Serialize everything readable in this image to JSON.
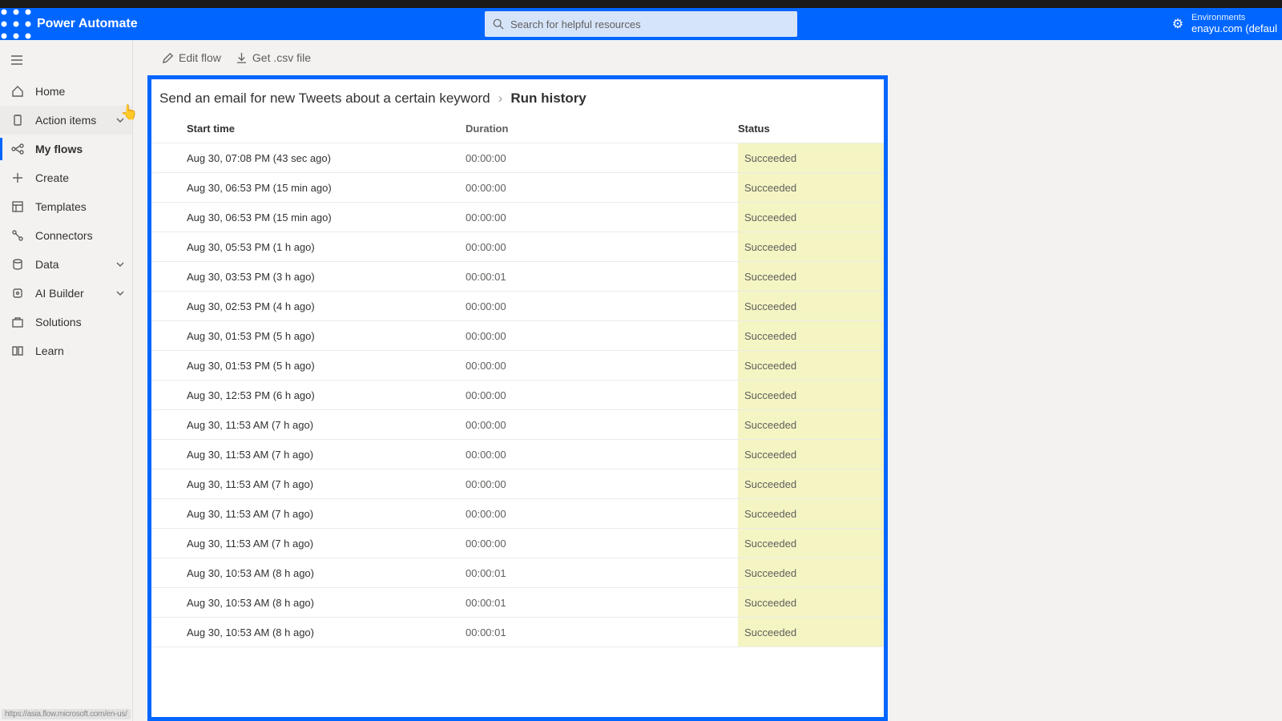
{
  "header": {
    "app_title": "Power Automate",
    "search_placeholder": "Search for helpful resources",
    "env_label": "Environments",
    "env_value": "enayu.com (defaul"
  },
  "sidebar": {
    "items": [
      {
        "label": "Home"
      },
      {
        "label": "Action items",
        "hovered": true,
        "has_expand": true
      },
      {
        "label": "My flows",
        "active": true
      },
      {
        "label": "Create"
      },
      {
        "label": "Templates"
      },
      {
        "label": "Connectors"
      },
      {
        "label": "Data",
        "has_expand": true
      },
      {
        "label": "AI Builder",
        "has_expand": true
      },
      {
        "label": "Solutions"
      },
      {
        "label": "Learn"
      }
    ]
  },
  "toolbar": {
    "edit_label": "Edit flow",
    "csv_label": "Get .csv file"
  },
  "breadcrumb": {
    "parent": "Send an email for new Tweets about a certain keyword",
    "current": "Run history"
  },
  "table": {
    "headers": {
      "start": "Start time",
      "duration": "Duration",
      "status": "Status"
    },
    "rows": [
      {
        "start": "Aug 30, 07:08 PM (43 sec ago)",
        "dur": "00:00:00",
        "stat": "Succeeded"
      },
      {
        "start": "Aug 30, 06:53 PM (15 min ago)",
        "dur": "00:00:00",
        "stat": "Succeeded"
      },
      {
        "start": "Aug 30, 06:53 PM (15 min ago)",
        "dur": "00:00:00",
        "stat": "Succeeded"
      },
      {
        "start": "Aug 30, 05:53 PM (1 h ago)",
        "dur": "00:00:00",
        "stat": "Succeeded"
      },
      {
        "start": "Aug 30, 03:53 PM (3 h ago)",
        "dur": "00:00:01",
        "stat": "Succeeded"
      },
      {
        "start": "Aug 30, 02:53 PM (4 h ago)",
        "dur": "00:00:00",
        "stat": "Succeeded"
      },
      {
        "start": "Aug 30, 01:53 PM (5 h ago)",
        "dur": "00:00:00",
        "stat": "Succeeded"
      },
      {
        "start": "Aug 30, 01:53 PM (5 h ago)",
        "dur": "00:00:00",
        "stat": "Succeeded"
      },
      {
        "start": "Aug 30, 12:53 PM (6 h ago)",
        "dur": "00:00:00",
        "stat": "Succeeded"
      },
      {
        "start": "Aug 30, 11:53 AM (7 h ago)",
        "dur": "00:00:00",
        "stat": "Succeeded"
      },
      {
        "start": "Aug 30, 11:53 AM (7 h ago)",
        "dur": "00:00:00",
        "stat": "Succeeded"
      },
      {
        "start": "Aug 30, 11:53 AM (7 h ago)",
        "dur": "00:00:00",
        "stat": "Succeeded"
      },
      {
        "start": "Aug 30, 11:53 AM (7 h ago)",
        "dur": "00:00:00",
        "stat": "Succeeded"
      },
      {
        "start": "Aug 30, 11:53 AM (7 h ago)",
        "dur": "00:00:00",
        "stat": "Succeeded"
      },
      {
        "start": "Aug 30, 10:53 AM (8 h ago)",
        "dur": "00:00:01",
        "stat": "Succeeded"
      },
      {
        "start": "Aug 30, 10:53 AM (8 h ago)",
        "dur": "00:00:01",
        "stat": "Succeeded"
      },
      {
        "start": "Aug 30, 10:53 AM (8 h ago)",
        "dur": "00:00:01",
        "stat": "Succeeded"
      }
    ]
  },
  "sidebar_icons": [
    "home-icon",
    "clipboard-icon",
    "flow-icon",
    "plus-icon",
    "template-icon",
    "connector-icon",
    "data-icon",
    "ai-icon",
    "solutions-icon",
    "learn-icon"
  ]
}
